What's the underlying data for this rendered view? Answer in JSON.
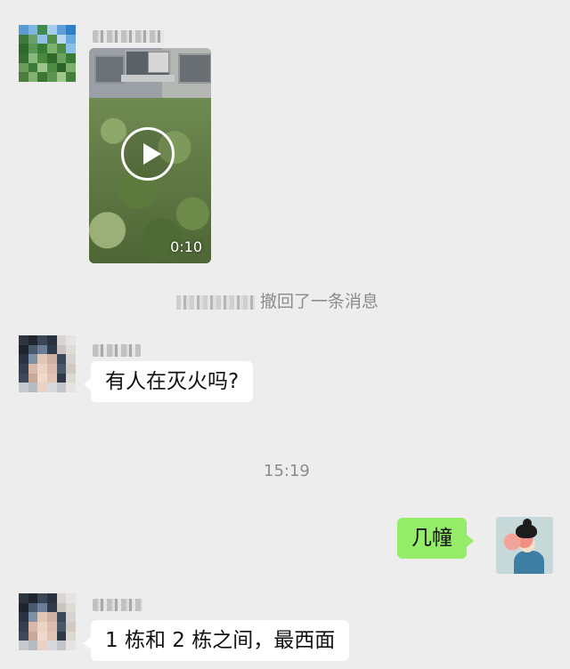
{
  "messages": {
    "video": {
      "duration": "0:10"
    },
    "system": {
      "recall_text": "撤回了一条消息"
    },
    "incoming_1": {
      "text": "有人在灭火吗?"
    },
    "timestamp": "15:19",
    "outgoing_1": {
      "text": "几幢"
    },
    "incoming_2": {
      "text": "1 栋和 2 栋之间，最西面"
    }
  },
  "colors": {
    "background": "#ededed",
    "incoming_bubble": "#ffffff",
    "outgoing_bubble": "#95ec69",
    "system_text": "#8c8c8c"
  },
  "icons": [
    "play-icon",
    "avatar",
    "bubble-tail"
  ]
}
